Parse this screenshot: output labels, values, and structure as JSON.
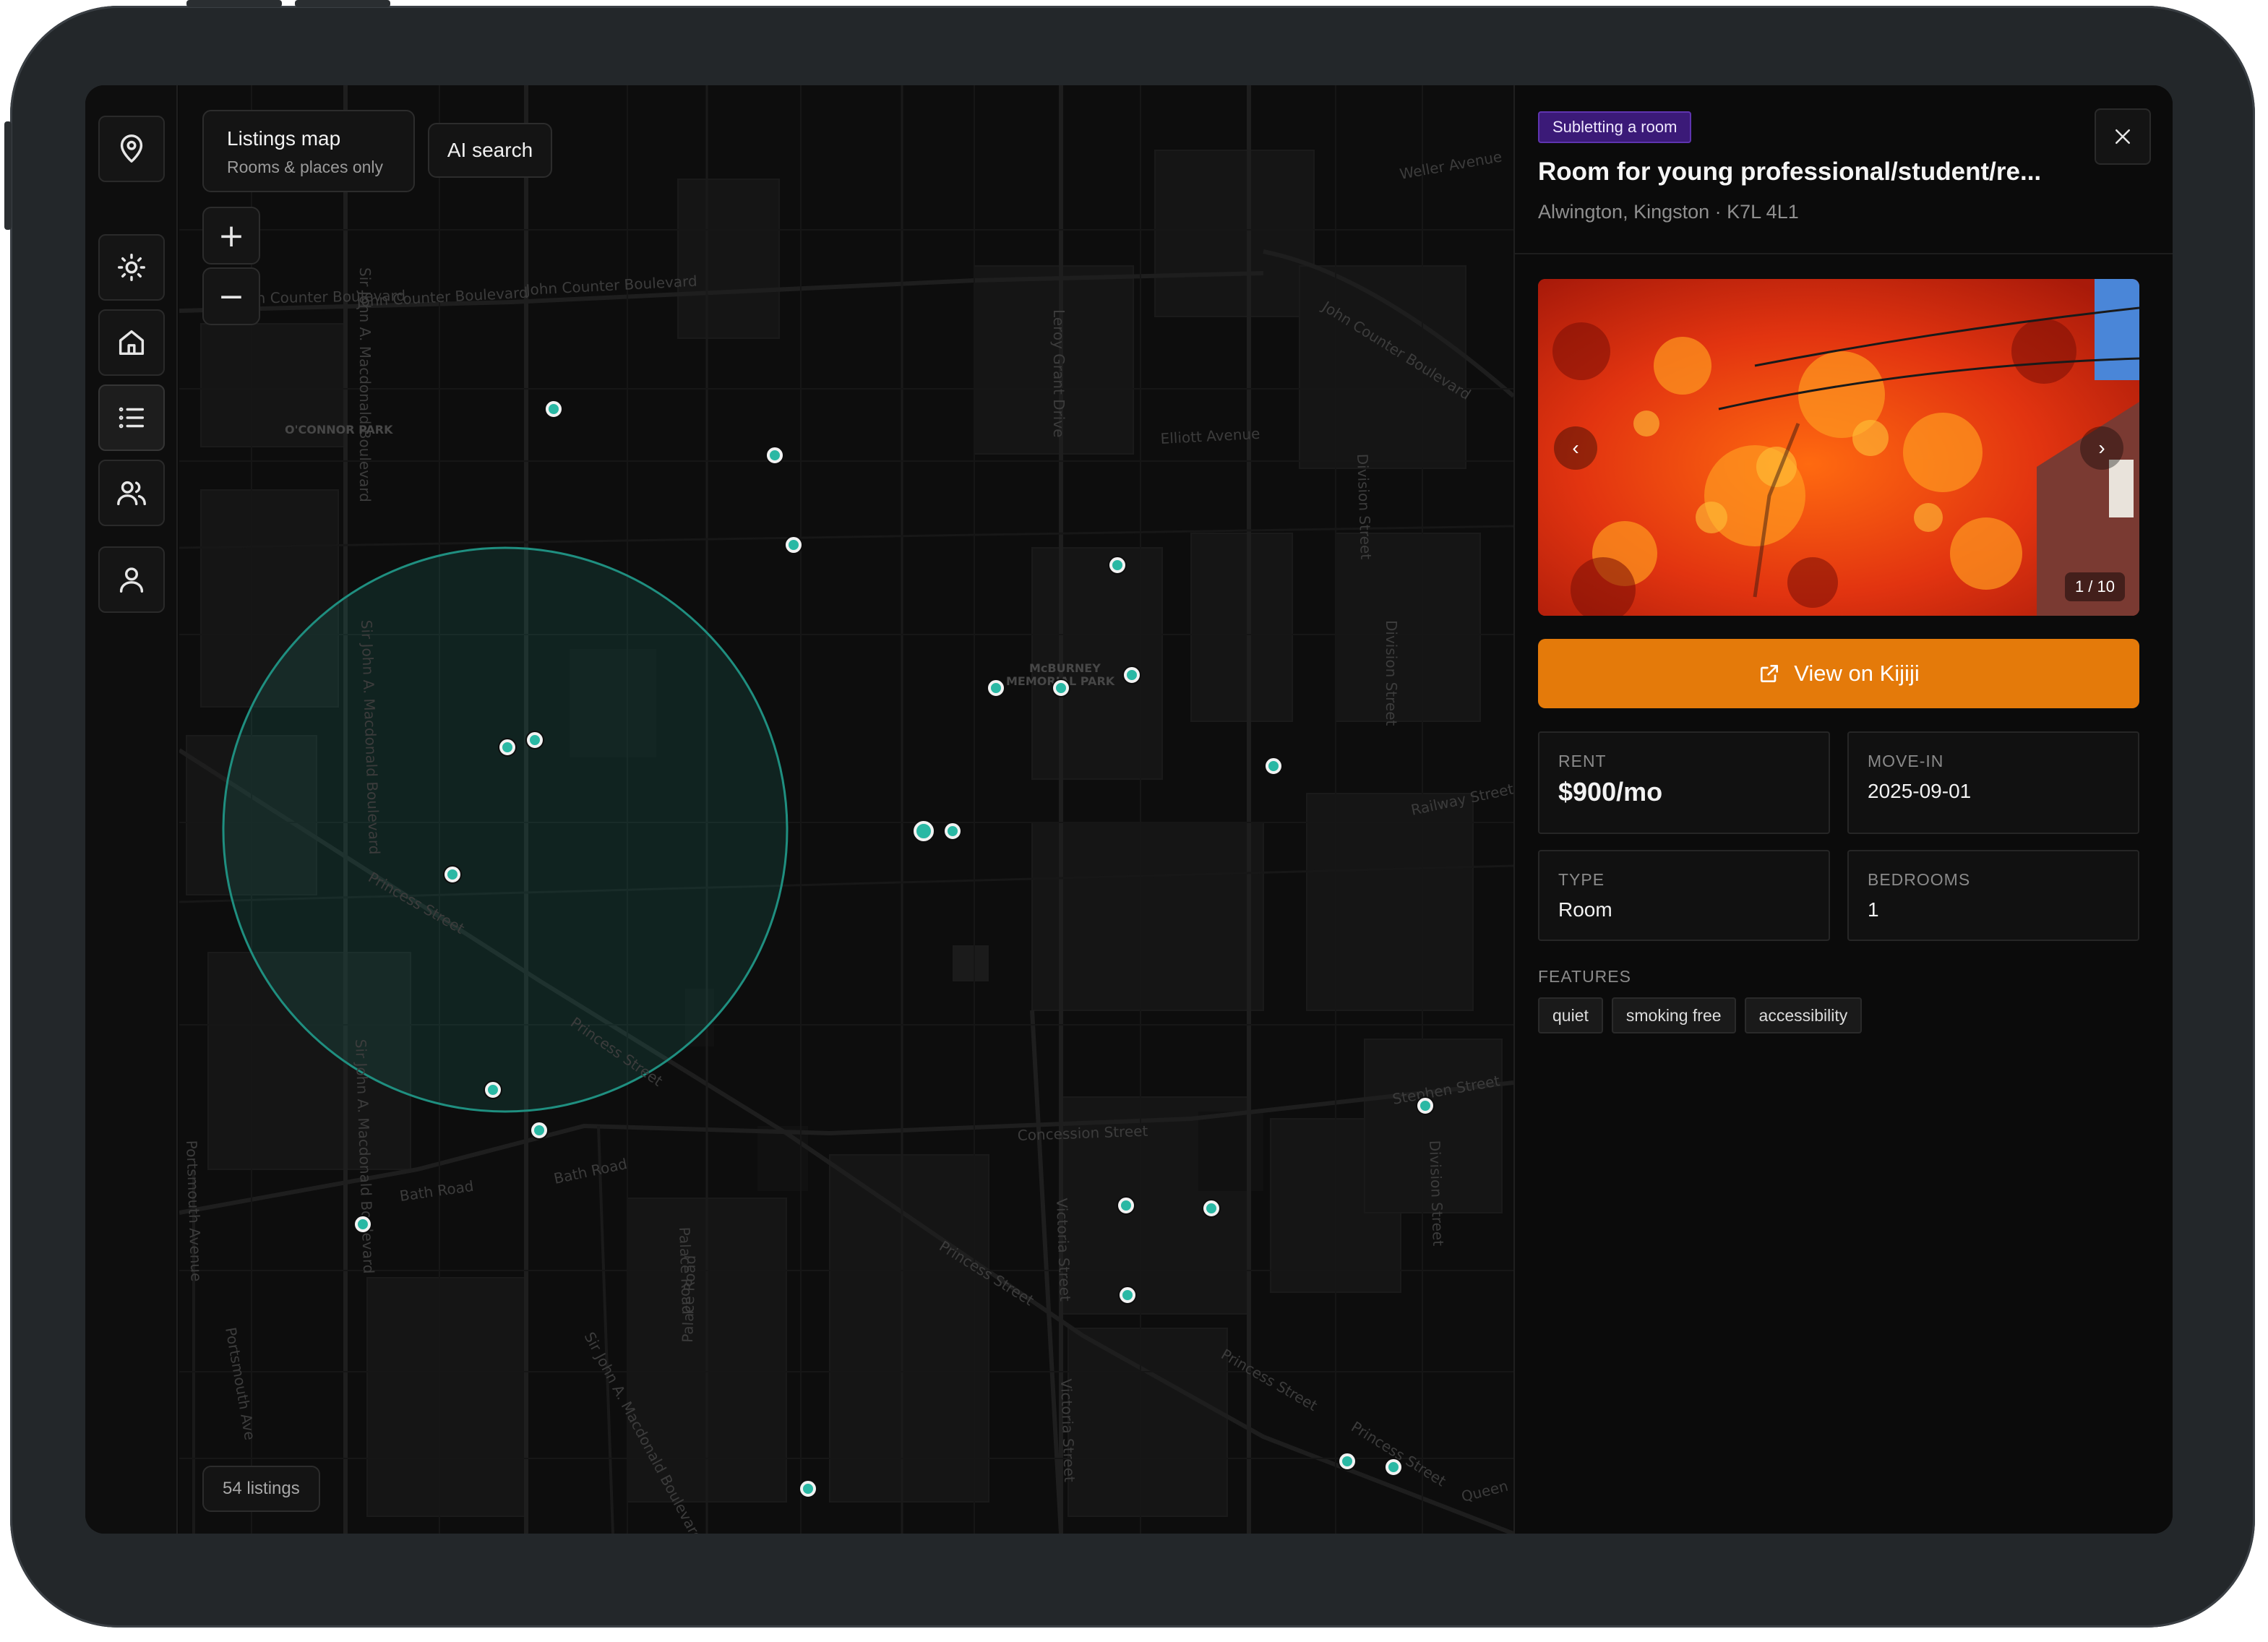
{
  "map": {
    "title": "Listings map",
    "subtitle": "Rooms & places only",
    "ai_search_label": "AI search",
    "zoom_in_label": "+",
    "zoom_out_label": "−",
    "listing_count": "54 listings",
    "street_labels": {
      "jcb1": "John Counter Boulevard",
      "jcb2": "John Counter Boulevard",
      "jcb3": "John Counter Boulevard",
      "jcb4": "John Counter Boulevard",
      "weller": "Weller Avenue",
      "elliott": "Elliott Avenue",
      "leroy": "Leroy Grant Drive",
      "sja1": "Sir John A. Macdonald Boulevard",
      "sja2": "Sir John A. Macdonald Boulevard",
      "sja3": "Sir John A. Macdonald Boulevard",
      "sja4": "Sir John A. Macdonald Boulevard",
      "division1": "Division Street",
      "division2": "Division Street",
      "division3": "Division Street",
      "railway": "Railway Street",
      "princess1": "Princess Street",
      "princess2": "Princess Street",
      "princess3": "Princess Street",
      "princess4": "Princess Street",
      "princess5": "Princess Street",
      "bath1": "Bath Road",
      "bath2": "Bath Road",
      "concession": "Concession Street",
      "stephen": "Stephen Street",
      "victoria1": "Victoria Street",
      "victoria2": "Victoria Street",
      "palace1": "Palace Road",
      "palace2": "Palace Road",
      "portsmouth1": "Portsmouth Avenue",
      "portsmouth2": "Portsmouth Ave",
      "queen": "Queen",
      "oconnor": "O'CONNOR PARK",
      "mcburney1": "McBURNEY",
      "mcburney2": "MEMORIAL PARK"
    }
  },
  "listing": {
    "tag": "Subletting a room",
    "title": "Room for young professional/student/re...",
    "location": "Alwington, Kingston · K7L 4L1",
    "photo_prev": "‹",
    "photo_next": "›",
    "photo_counter": "1 / 10",
    "external_button": "View on Kijiji",
    "rent_label": "RENT",
    "rent_value": "$900/mo",
    "movein_label": "MOVE-IN",
    "movein_value": "2025-09-01",
    "type_label": "TYPE",
    "type_value": "Room",
    "bedrooms_label": "BEDROOMS",
    "bedrooms_value": "1",
    "features_label": "FEATURES",
    "features": [
      "quiet",
      "smoking free",
      "accessibility"
    ]
  },
  "colors": {
    "accent_teal": "#2ab8a4",
    "kijiji_orange": "#e47a0a",
    "tag_purple": "#3b1a78"
  },
  "icons": [
    "location-pin-icon",
    "sun-icon",
    "home-icon",
    "list-icon",
    "users-icon",
    "user-icon",
    "close-icon",
    "external-link-icon"
  ]
}
